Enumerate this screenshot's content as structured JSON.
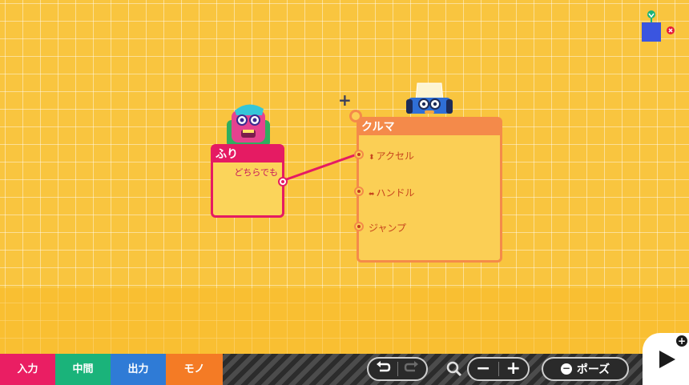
{
  "nodes": {
    "furi": {
      "title": "ふり",
      "output_label": "どちらでも"
    },
    "car": {
      "title": "クルマ",
      "inputs": [
        {
          "glyph": "⬍",
          "label": "アクセル"
        },
        {
          "glyph": "⬌",
          "label": "ハンドル"
        },
        {
          "glyph": "",
          "label": "ジャンプ"
        }
      ]
    }
  },
  "toolbar": {
    "categories": {
      "input": "入力",
      "middle": "中間",
      "output": "出力",
      "object": "モノ"
    },
    "undo_icon": "undo-icon",
    "redo_icon": "redo-icon",
    "zoom_icon": "magnifier-icon",
    "zoom_out": "−",
    "zoom_in": "+",
    "pause_icon_glyph": "−",
    "pause_label": "ポーズ",
    "play_plus": "+"
  },
  "cursor_glyph": "+",
  "colors": {
    "background": "#f9c53f",
    "furi_node": "#e51b63",
    "car_node": "#f48a4a",
    "input_tab": "#ea1e63",
    "middle_tab": "#1ab37a",
    "output_tab": "#2f7bd6",
    "object_tab": "#f47b25",
    "wire": "#e51b63"
  }
}
